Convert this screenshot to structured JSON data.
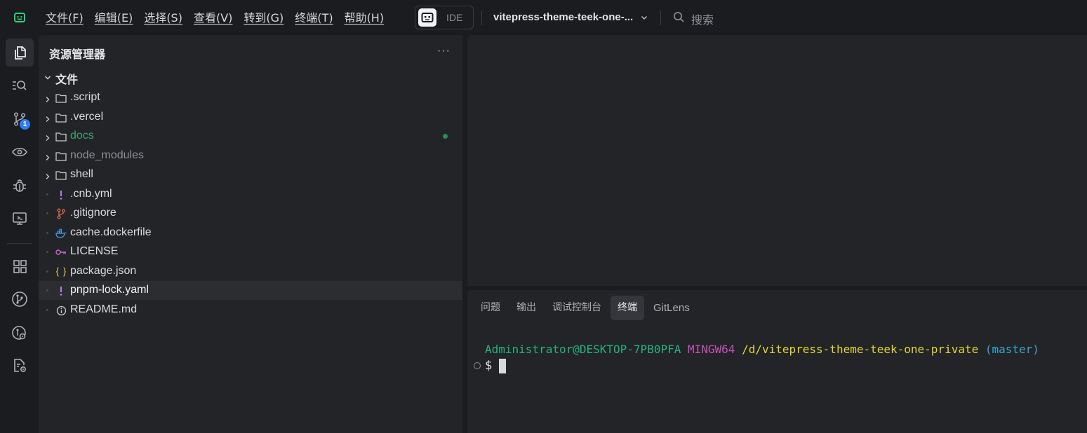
{
  "menu": {
    "items": [
      "文件(F)",
      "编辑(E)",
      "选择(S)",
      "查看(V)",
      "转到(G)",
      "终端(T)",
      "帮助(H)"
    ]
  },
  "ide_switch": {
    "label": "IDE"
  },
  "project": {
    "name": "vitepress-theme-teek-one-..."
  },
  "search": {
    "placeholder": "搜索"
  },
  "activity": {
    "scm_badge": "1",
    "icons": [
      "explorer-icon",
      "search-icon",
      "source-control-icon",
      "preview-icon",
      "debug-icon",
      "remote-explorer-icon",
      "extensions-icon",
      "git-graph-icon",
      "gitlens-icon",
      "settings-sync-icon"
    ]
  },
  "explorer": {
    "title": "资源管理器",
    "more": "···",
    "root": "文件",
    "items": [
      {
        "name": ".script",
        "type": "folder"
      },
      {
        "name": ".vercel",
        "type": "folder"
      },
      {
        "name": "docs",
        "type": "folder",
        "status": "modified"
      },
      {
        "name": "node_modules",
        "type": "folder",
        "status": "ignored"
      },
      {
        "name": "shell",
        "type": "folder"
      },
      {
        "name": ".cnb.yml",
        "type": "yaml"
      },
      {
        "name": ".gitignore",
        "type": "git"
      },
      {
        "name": "cache.dockerfile",
        "type": "docker"
      },
      {
        "name": "LICENSE",
        "type": "license"
      },
      {
        "name": "package.json",
        "type": "json"
      },
      {
        "name": "pnpm-lock.yaml",
        "type": "yaml",
        "selected": true
      },
      {
        "name": "README.md",
        "type": "info"
      }
    ]
  },
  "panel": {
    "tabs": [
      "问题",
      "输出",
      "调试控制台",
      "终端",
      "GitLens"
    ],
    "active_tab": "终端"
  },
  "terminal": {
    "user_host": "Administrator@DESKTOP-7PB0PFA",
    "env": "MINGW64",
    "path": "/d/vitepress-theme-teek-one-private",
    "branch": "(master)",
    "prompt": "$"
  },
  "colors": {
    "background": "#1b1c1f",
    "panel": "#232427",
    "green": "#24b47e",
    "magenta": "#c951c0",
    "yellow": "#e5d636",
    "cyan": "#33a6d4",
    "badge": "#2f7cf6"
  }
}
